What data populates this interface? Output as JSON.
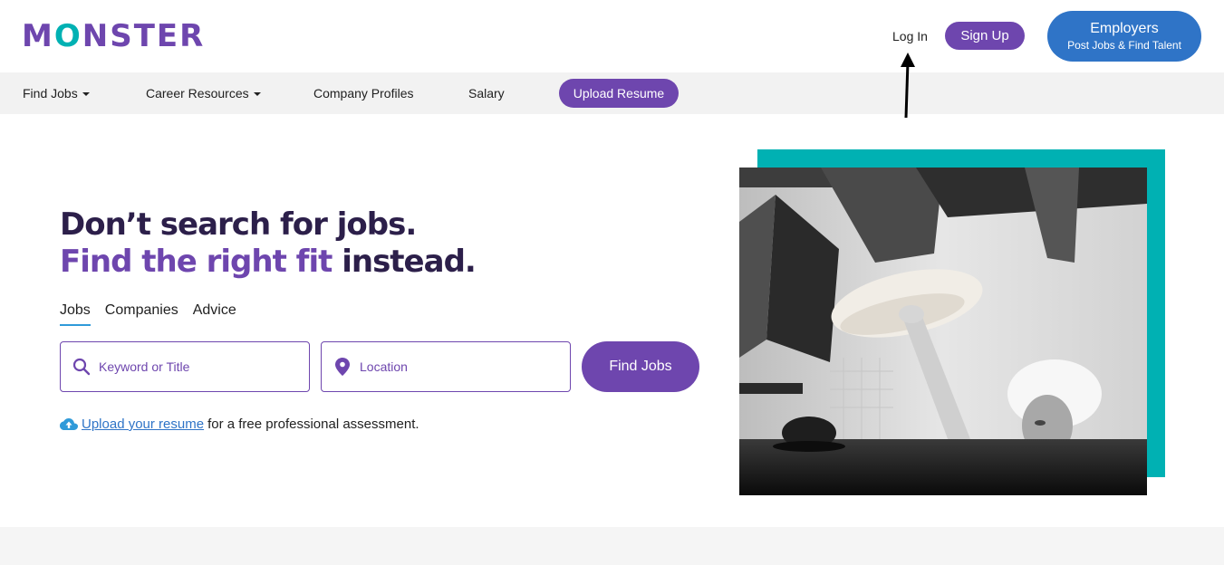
{
  "header": {
    "logo_prefix": "M",
    "logo_o": "O",
    "logo_suffix": "NSTER",
    "login_label": "Log In",
    "signup_label": "Sign Up",
    "employers_title": "Employers",
    "employers_subtitle": "Post Jobs & Find Talent"
  },
  "nav": {
    "items": [
      {
        "label": "Find Jobs",
        "has_dropdown": true
      },
      {
        "label": "Career Resources",
        "has_dropdown": true
      },
      {
        "label": "Company Profiles",
        "has_dropdown": false
      },
      {
        "label": "Salary",
        "has_dropdown": false
      }
    ],
    "upload_resume_label": "Upload Resume"
  },
  "hero": {
    "headline_line1": "Don’t search for jobs.",
    "headline_line2_highlight": "Find the right fit",
    "headline_line2_rest": " instead.",
    "tabs": [
      {
        "label": "Jobs",
        "active": true
      },
      {
        "label": "Companies",
        "active": false
      },
      {
        "label": "Advice",
        "active": false
      }
    ],
    "search": {
      "keyword_placeholder": "Keyword or Title",
      "keyword_icon": "search-icon",
      "location_placeholder": "Location",
      "location_icon": "map-pin-icon",
      "button_label": "Find Jobs"
    },
    "upload": {
      "icon": "cloud-upload-icon",
      "link_text": "Upload your resume",
      "rest_text": "for a free professional assessment."
    }
  },
  "colors": {
    "brand_purple": "#6e46ae",
    "brand_teal": "#00b1b3",
    "employers_blue": "#2f74c7",
    "headline_dark": "#2c1f4a",
    "nav_bg": "#f2f2f2"
  }
}
